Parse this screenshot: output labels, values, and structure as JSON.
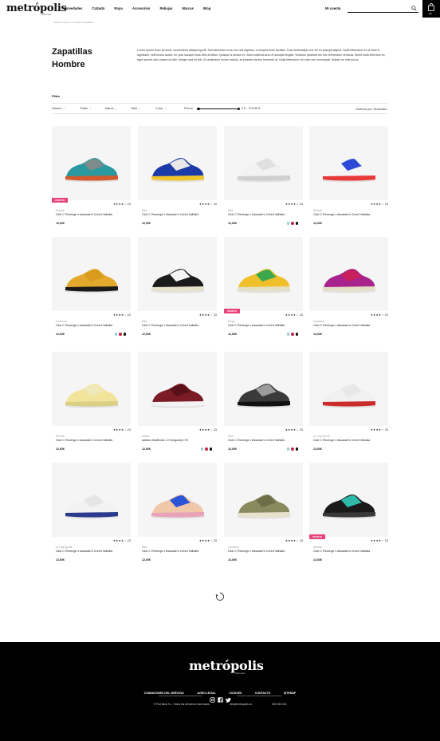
{
  "header": {
    "logo": "metrópolis",
    "logo_sub": "urban wear",
    "nav": [
      "Novedades",
      "Calzado",
      "Ropa",
      "Accesorios",
      "Rebajas",
      "Marcas",
      "Blog"
    ],
    "account": "Mi cuenta",
    "cart_count": "(0)"
  },
  "breadcrumb": "Estás en Home / Calzado / Zapatillas",
  "page": {
    "title_line1": "Zapatillas",
    "title_line2": "Hombre",
    "description": "Lorem ipsum dolor sit amet, consectetur adipiscing elit. Sed bibendum eros non nisi dapibus, ut tempus enim facilisis. Cras scelerisque orci vel ex suscipit aliquet. Nulla bibendum ex at viverra dignissim, velit lectus auctor mi, quis suscipit risus nibh at tellus. Quisque a dictum ex. Duis euismod arcu et suscipit feugiat. Vivamus pharetra leo nec fermentum vehicula. Morbi nulla interdum ex, eget laoreet odio massa ut nibh. Integer sed mi elit. Ut vestibulum lectus mauris, ac pharetra lectus hendrerit at. Nulla bibendum vel enim nec consequat. Nullam ac velit purus."
  },
  "filters": {
    "label": "Filtro",
    "items": [
      "Género",
      "Estilo",
      "Marca",
      "Talla",
      "Color"
    ],
    "price_label": "Precio",
    "price_range": "0 € - 275,05 €",
    "sort": "Ordenar por: Novedad"
  },
  "products": [
    {
      "brand": "Reebok",
      "name": "Club C Revenge x Assassin's Creed Valhalla",
      "price": "12,60€",
      "stars": "★★★★☆ 23",
      "badge": "OFERTA",
      "swatches": []
    },
    {
      "brand": "Nike",
      "name": "Club C Revenge x Assassin's Creed Valhalla",
      "price": "12,60€",
      "stars": "★★★★☆ 23",
      "badge": "",
      "swatches": []
    },
    {
      "brand": "Nike",
      "name": "Club C Revenge x Assassin's Creed Valhalla",
      "price": "12,60€",
      "stars": "★★★★☆ 23",
      "badge": "",
      "swatches": [
        "#8ecfd9",
        "#c62a45",
        "#111111"
      ]
    },
    {
      "brand": "Reebok",
      "name": "Club C Revenge x Assassin's Creed Valhalla",
      "price": "12,60€",
      "stars": "★★★★☆ 23",
      "badge": "",
      "swatches": []
    },
    {
      "brand": "Converse",
      "name": "Club C Revenge x Assassin's Creed Valhalla",
      "price": "12,60€",
      "stars": "★★★★☆ 23",
      "badge": "",
      "swatches": [
        "#8ecfd9",
        "#c62a45",
        "#111111"
      ]
    },
    {
      "brand": "Nike",
      "name": "Club C Revenge x Assassin's Creed Valhalla",
      "price": "12,60€",
      "stars": "★★★★☆ 23",
      "badge": "",
      "swatches": []
    },
    {
      "brand": "Puma",
      "name": "Club C Revenge x Assassin's Creed Valhalla",
      "price": "12,60€",
      "stars": "★★★★☆ 23",
      "badge": "OFERTA",
      "swatches": [
        "#8ecfd9",
        "#c62a45",
        "#111111"
      ]
    },
    {
      "brand": "Converse",
      "name": "Club C Revenge x Assassin's Creed Valhalla",
      "price": "12,60€",
      "stars": "★★★★☆ 23",
      "badge": "",
      "swatches": []
    },
    {
      "brand": "Reebok",
      "name": "Club C Revenge x Assassin's Creed Valhalla",
      "price": "12,60€",
      "stars": "★★★★☆ 23",
      "badge": "",
      "swatches": []
    },
    {
      "brand": "Adidas",
      "name": "adidas UltraBoost 1.0 Burgundy LTD",
      "price": "12,60€",
      "stars": "★★★★☆ 23",
      "badge": "",
      "swatches": [
        "#8ecfd9",
        "#c62a45",
        "#111111"
      ]
    },
    {
      "brand": "Nike",
      "name": "Club C Revenge x Assassin's Creed Valhalla",
      "price": "12,60€",
      "stars": "★★★★☆ 23",
      "badge": "",
      "swatches": [
        "#8ecfd9",
        "#c62a45",
        "#111111"
      ]
    },
    {
      "brand": "Le Coq Sportif",
      "name": "Club C Revenge x Assassin's Creed Valhalla",
      "price": "12,60€",
      "stars": "★★★★☆ 23",
      "badge": "",
      "swatches": []
    },
    {
      "brand": "Le Coq Sportif",
      "name": "Club C Revenge x Assassin's Creed Valhalla",
      "price": "12,60€",
      "stars": "★★★★☆ 23",
      "badge": "",
      "swatches": []
    },
    {
      "brand": "Nike",
      "name": "Club C Revenge x Assassin's Creed Valhalla",
      "price": "12,60€",
      "stars": "★★★★☆ 23",
      "badge": "",
      "swatches": []
    },
    {
      "brand": "Converse",
      "name": "Club C Revenge x Assassin's Creed Valhalla",
      "price": "12,60€",
      "stars": "★★★★☆ 23",
      "badge": "",
      "swatches": []
    },
    {
      "brand": "Reebok",
      "name": "Club C Revenge x Assassin's Creed Valhalla",
      "price": "12,60€",
      "stars": "★★★★☆ 23",
      "badge": "OFERTA",
      "swatches": []
    }
  ],
  "product_colors": [
    [
      "#2b9aa0",
      "#7d8b8a",
      "#d35a2d"
    ],
    [
      "#1a3aa8",
      "#e8e8e8",
      "#f0c52b"
    ],
    [
      "#f2f2f2",
      "#e0e0e0",
      "#cfcfcf"
    ],
    [
      "#f5f5f5",
      "#2b4bd6",
      "#e83a3a"
    ],
    [
      "#e2a92c",
      "#d99a1e",
      "#1a1a1a"
    ],
    [
      "#1b1b1b",
      "#f5f5f5",
      "#e8e2cc"
    ],
    [
      "#f0c02b",
      "#3ba84e",
      "#e4e0c5"
    ],
    [
      "#a8238c",
      "#c81f5d",
      "#e6dfc8"
    ],
    [
      "#f2e49a",
      "#efe8b8",
      "#d9cf85"
    ],
    [
      "#7a1b25",
      "#5a1018",
      "#f2f2f2"
    ],
    [
      "#3a3a3a",
      "#9c9c9c",
      "#111111"
    ],
    [
      "#f0f0f0",
      "#e8e8e8",
      "#cc2b2b"
    ],
    [
      "#f2f2f2",
      "#e5e5e5",
      "#2b3a8c"
    ],
    [
      "#f0c7a8",
      "#2b55d6",
      "#e9a3b8"
    ],
    [
      "#8a8a5e",
      "#6e6e48",
      "#e8e2cc"
    ],
    [
      "#1a1a1a",
      "#2fb9a8",
      "#3a3a3a"
    ]
  ],
  "footer": {
    "logo": "metrópolis",
    "logo_sub": "urban wear",
    "links": [
      "CONDICIONES DEL SERVICIO",
      "AVISO LEGAL",
      "COOKIES",
      "CONTACTO",
      "SITEMAP"
    ],
    "copyright": "© Pod Ibiza S.L. Todos los derechos reservados",
    "email": "info@metropolis.es",
    "phone": "000 250 024"
  },
  "colors": {
    "accent_yellow": "#f4ec3a",
    "badge_pink": "#e8427a",
    "footer_bg": "#000000"
  }
}
